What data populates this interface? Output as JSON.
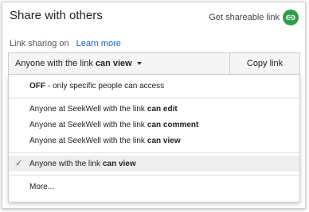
{
  "header": {
    "title": "Share with others",
    "get_link_label": "Get shareable link"
  },
  "sharing": {
    "status": "Link sharing on",
    "learn_more": "Learn more"
  },
  "select": {
    "prefix": "Anyone with the link",
    "bold": "can view",
    "copy_label": "Copy link"
  },
  "menu": {
    "items": [
      {
        "bold": "OFF",
        "text": "- only specific people can access"
      },
      {
        "text": "Anyone at SeekWell with the link",
        "bold": "can edit"
      },
      {
        "text": "Anyone at SeekWell with the link",
        "bold": "can comment"
      },
      {
        "text": "Anyone at SeekWell with the link",
        "bold": "can view"
      },
      {
        "text": "Anyone with the link",
        "bold": "can view",
        "selected": true
      },
      {
        "text": "More..."
      }
    ]
  },
  "colors": {
    "accent_green": "#2e9e4b",
    "link_blue": "#1a5fd0"
  },
  "icons": {
    "link": "link-icon",
    "check": "check-icon",
    "caret": "caret-down-icon"
  }
}
